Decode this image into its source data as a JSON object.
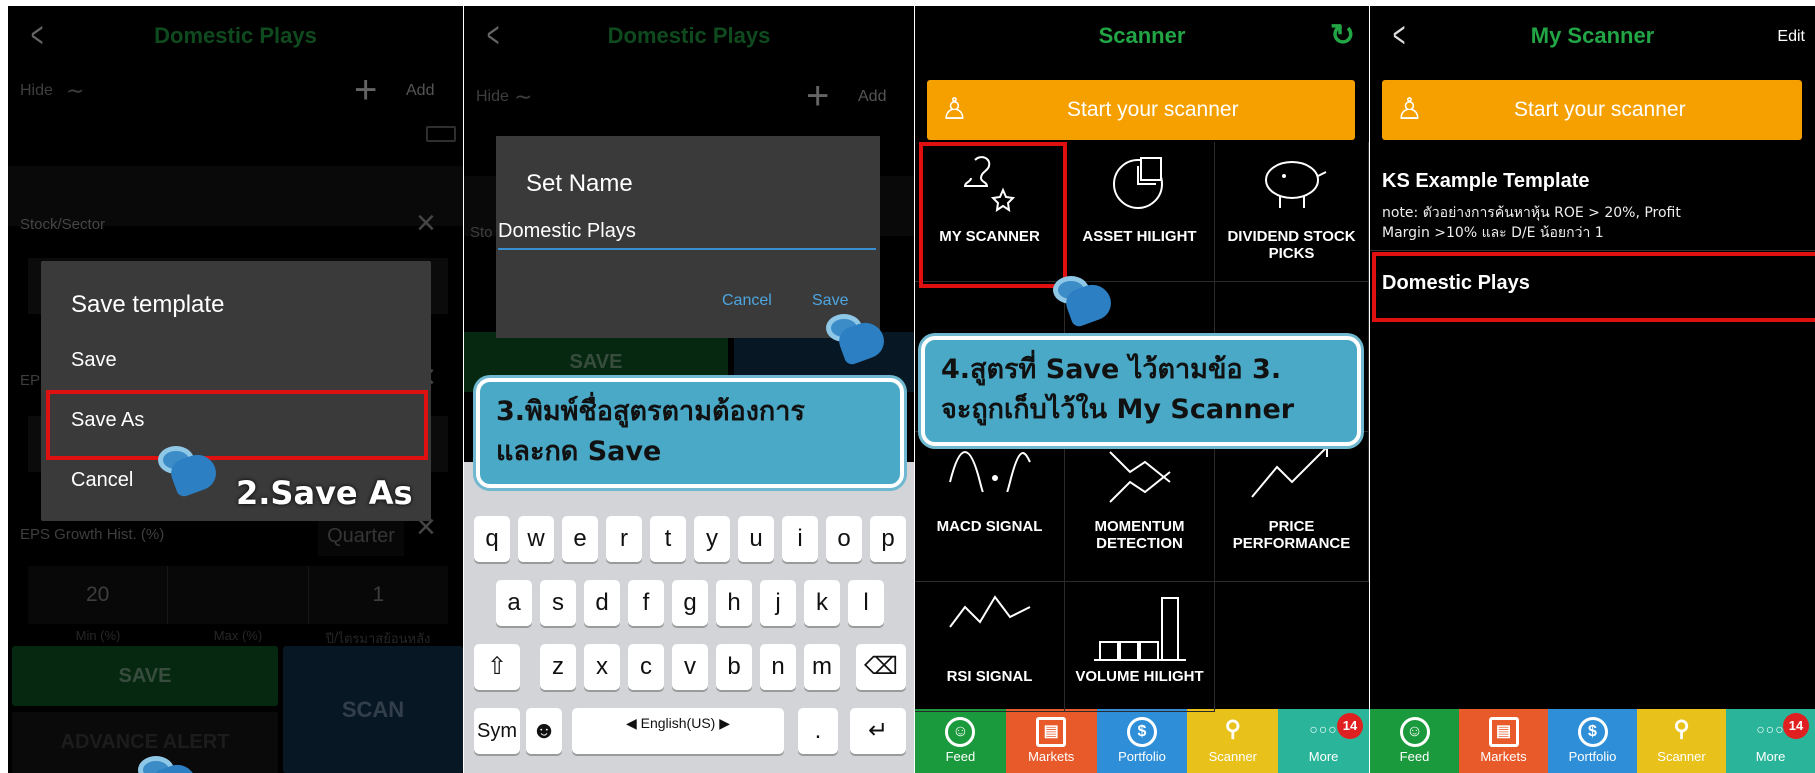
{
  "panel1": {
    "title": "Domestic Plays",
    "hide_label": "Hide",
    "add_label": "Add",
    "stock_sector_label": "Stock/Sector",
    "eps_prefix": "EP",
    "dialog": {
      "title": "Save template",
      "options": [
        "Save",
        "Save As",
        "Cancel"
      ]
    },
    "eps_growth_label": "EPS Growth Hist. (%)",
    "period_value": "Quarter",
    "min_value": "20",
    "max_value": "",
    "years_value": "1",
    "min_label": "Min (%)",
    "max_label": "Max (%)",
    "years_label": "ปี/ไตรมาสย้อนหลัง",
    "save_button": "SAVE",
    "scan_button": "SCAN",
    "advance_alert": "ADVANCE ALERT",
    "step_label": "2.Save As"
  },
  "panel2": {
    "title": "Domestic Plays",
    "hide_label": "Hide",
    "add_label": "Add",
    "stock_prefix": "Sto",
    "dialog": {
      "title": "Set Name",
      "input_value": "Domestic Plays",
      "cancel": "Cancel",
      "save": "Save"
    },
    "save_button": "SAVE",
    "callout_line1": "3.พิมพ์ชื่อสูตรตามต้องการ",
    "callout_line2": "และกด Save",
    "keyboard": {
      "row1": [
        "q",
        "w",
        "e",
        "r",
        "t",
        "y",
        "u",
        "i",
        "o",
        "p"
      ],
      "row2": [
        "a",
        "s",
        "d",
        "f",
        "g",
        "h",
        "j",
        "k",
        "l"
      ],
      "row3": [
        "z",
        "x",
        "c",
        "v",
        "b",
        "n",
        "m"
      ],
      "shift": "⇧",
      "backspace": "⌫",
      "sym": "Sym",
      "emoji": "☻",
      "language": "◀ English(US) ▶",
      "period": ".",
      "enter": "↵"
    }
  },
  "panel3": {
    "title": "Scanner",
    "refresh_icon": "↻",
    "start_label": "Start your scanner",
    "tiles": [
      {
        "label": "MY SCANNER",
        "icon": "user-star-icon"
      },
      {
        "label": "ASSET HILIGHT",
        "icon": "pie-icon"
      },
      {
        "label": "DIVIDEND STOCK PICKS",
        "icon": "piggy-bank-icon"
      },
      {
        "label": "MACD SIGNAL",
        "icon": "wave-icon"
      },
      {
        "label": "MOMENTUM DETECTION",
        "icon": "zigzag-icon"
      },
      {
        "label": "PRICE PERFORMANCE",
        "icon": "trend-up-icon"
      },
      {
        "label": "RSI SIGNAL",
        "icon": "rsi-icon"
      },
      {
        "label": "VOLUME HILIGHT",
        "icon": "bars-icon"
      }
    ],
    "callout_line1": "4.สูตรที่ Save ไว้ตามข้อ 3.",
    "callout_line2": "จะถูกเก็บไว้ใน My Scanner"
  },
  "panel4": {
    "title": "My Scanner",
    "edit_label": "Edit",
    "start_label": "Start your scanner",
    "template_title": "KS Example Template",
    "template_note_line1": "note: ตัวอย่างการค้นหาหุ้น ROE > 20%, Profit",
    "template_note_line2": "Margin >10% และ D/E น้อยกว่า 1",
    "saved_item": "Domestic Plays"
  },
  "tabbar": {
    "tabs": [
      {
        "label": "Feed",
        "color": "#1a9a3c"
      },
      {
        "label": "Markets",
        "color": "#e85a2a"
      },
      {
        "label": "Portfolio",
        "color": "#2e8fd8"
      },
      {
        "label": "Scanner",
        "color": "#e8c21a"
      },
      {
        "label": "More",
        "color": "#2ab59a"
      }
    ],
    "badge": "14"
  },
  "colors": {
    "accent_green": "#22a545",
    "orange": "#f6a000",
    "highlight_red": "#e01010",
    "callout_blue": "#4aa9c7"
  }
}
